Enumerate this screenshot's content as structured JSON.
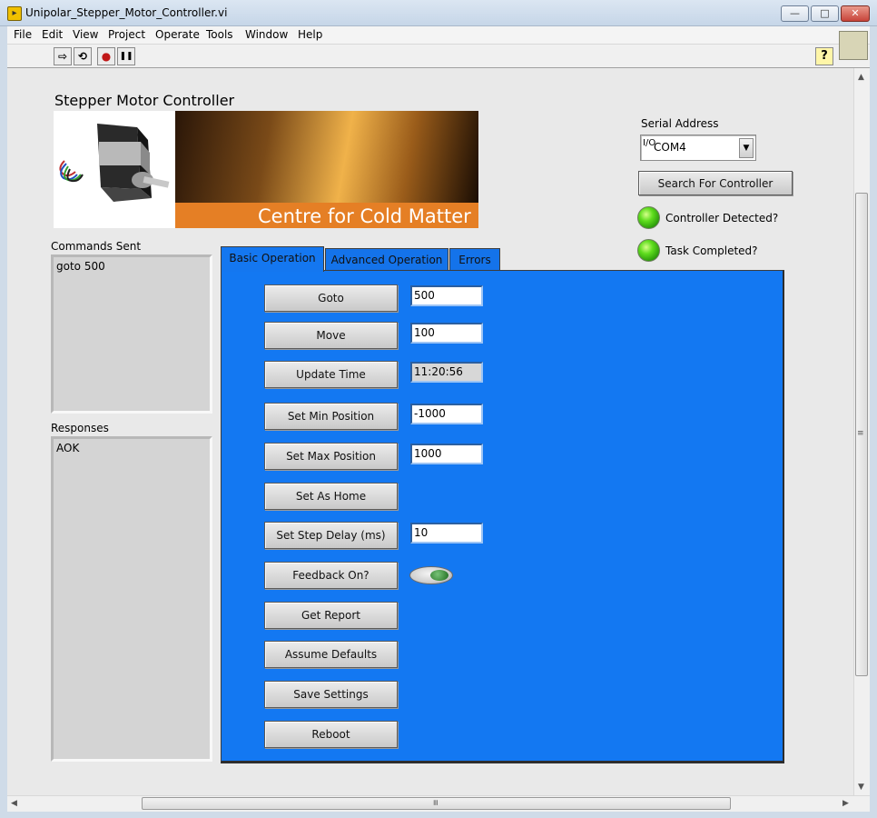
{
  "window": {
    "title": "Unipolar_Stepper_Motor_Controller.vi",
    "minimize": "—",
    "maximize": "□",
    "close": "✕"
  },
  "menu": [
    "File",
    "Edit",
    "View",
    "Project",
    "Operate",
    "Tools",
    "Window",
    "Help"
  ],
  "toolbar": {
    "run": "⇨",
    "run_continuously": "⟲",
    "abort": "●",
    "pause": "❚❚",
    "help": "?"
  },
  "panel": {
    "title": "Stepper Motor Controller",
    "banner_text": "Centre for Cold Matter"
  },
  "commands": {
    "label": "Commands Sent",
    "value": "goto 500"
  },
  "responses": {
    "label": "Responses",
    "value": "AOK"
  },
  "serial": {
    "label": "Serial Address",
    "io_icon": "I/O",
    "value": "COM4",
    "search_button": "Search For Controller"
  },
  "indicators": {
    "controller_detected": "Controller Detected?",
    "task_completed": "Task Completed?"
  },
  "tabs": [
    "Basic Operation",
    "Advanced Operation",
    "Errors"
  ],
  "basic": {
    "goto": {
      "label": "Goto",
      "value": "500"
    },
    "move": {
      "label": "Move",
      "value": "100"
    },
    "update_time": {
      "label": "Update Time",
      "value": "11:20:56"
    },
    "set_min": {
      "label": "Set Min Position",
      "value": "-1000"
    },
    "set_max": {
      "label": "Set Max Position",
      "value": "1000"
    },
    "set_home": {
      "label": "Set As Home"
    },
    "step_delay": {
      "label": "Set Step Delay (ms)",
      "value": "10"
    },
    "feedback": {
      "label": "Feedback On?"
    },
    "get_report": {
      "label": "Get Report"
    },
    "assume_defaults": {
      "label": "Assume Defaults"
    },
    "save_settings": {
      "label": "Save Settings"
    },
    "reboot": {
      "label": "Reboot"
    }
  },
  "colors": {
    "tab_panel": "#1378f2",
    "banner_strip": "#e57f25",
    "led_on": "#5fdd1e"
  },
  "scrollbars": {
    "up": "▲",
    "down": "▼",
    "left": "◀",
    "right": "▶",
    "grip": "≡"
  }
}
